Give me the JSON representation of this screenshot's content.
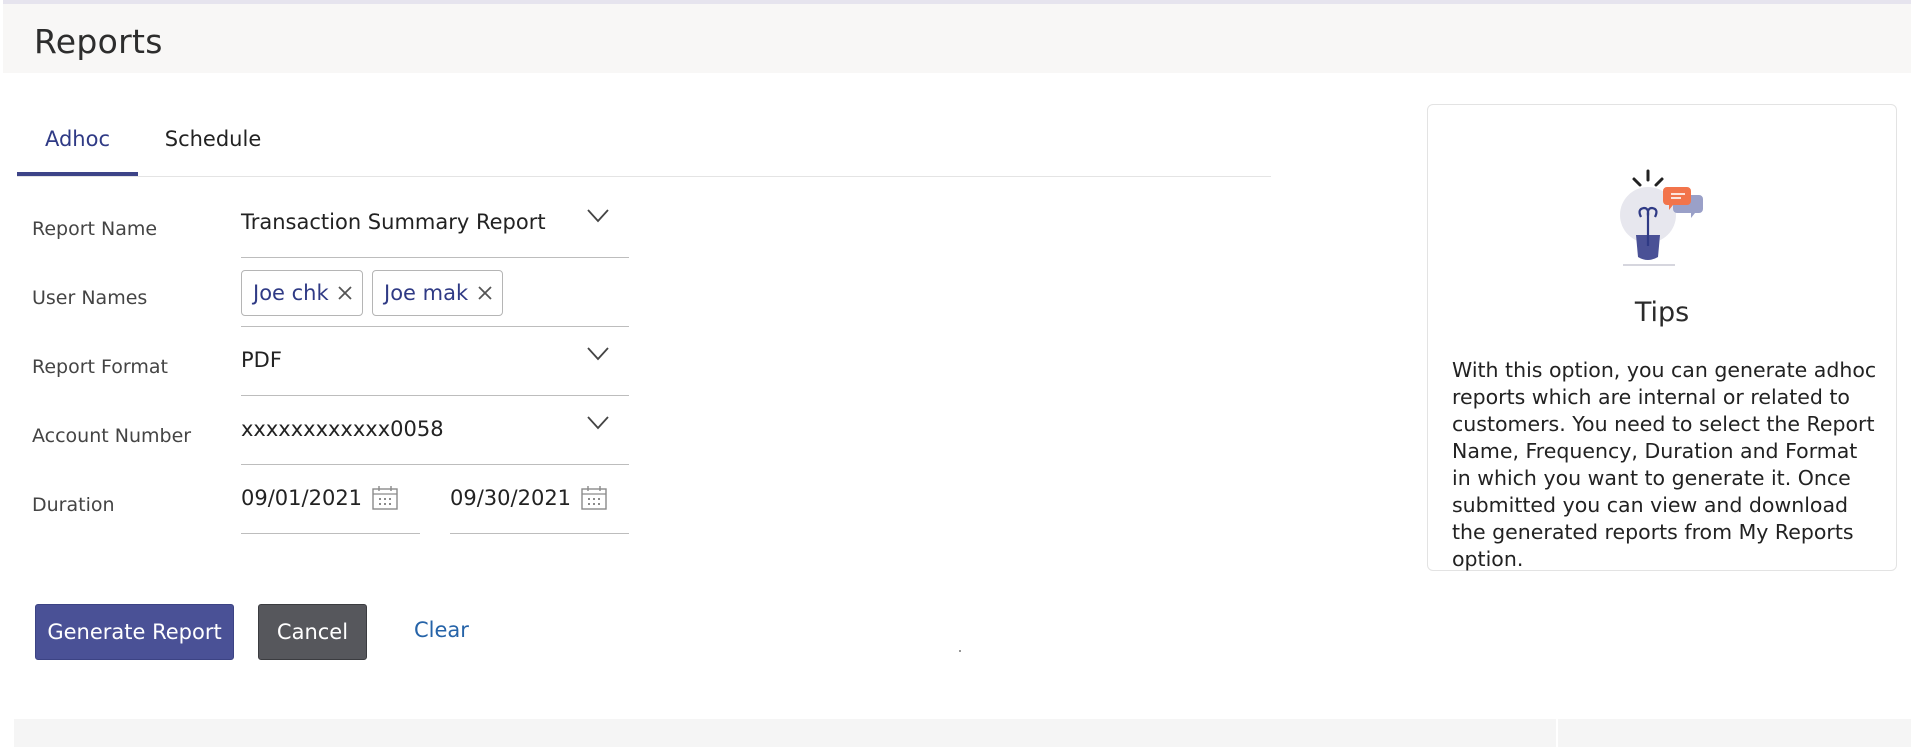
{
  "header": {
    "title": "Reports"
  },
  "tabs": [
    {
      "label": "Adhoc",
      "active": true
    },
    {
      "label": "Schedule",
      "active": false
    }
  ],
  "form": {
    "report_name": {
      "label": "Report Name",
      "value": "Transaction Summary Report"
    },
    "user_names": {
      "label": "User Names",
      "chips": [
        "Joe chk",
        "Joe mak"
      ]
    },
    "report_format": {
      "label": "Report Format",
      "value": "PDF"
    },
    "account_number": {
      "label": "Account Number",
      "value": "xxxxxxxxxxxx0058"
    },
    "duration": {
      "label": "Duration",
      "from": "09/01/2021",
      "to": "09/30/2021"
    }
  },
  "actions": {
    "generate_label": "Generate Report",
    "cancel_label": "Cancel",
    "clear_label": "Clear"
  },
  "tips": {
    "title": "Tips",
    "text": "With this option, you can generate adhoc reports which are internal or related to customers. You need to select the Report Name, Frequency, Duration and Format in which you want to generate it. Once submitted you can view and download the generated reports from My Reports option."
  },
  "colors": {
    "accent": "#2f3a85",
    "primary_button": "#4a5196",
    "secondary_button": "#56575c",
    "link": "#2563a8"
  },
  "icons": [
    "chevron-down-icon",
    "close-icon",
    "calendar-icon",
    "lightbulb-icon",
    "chat-bubble-icon"
  ]
}
